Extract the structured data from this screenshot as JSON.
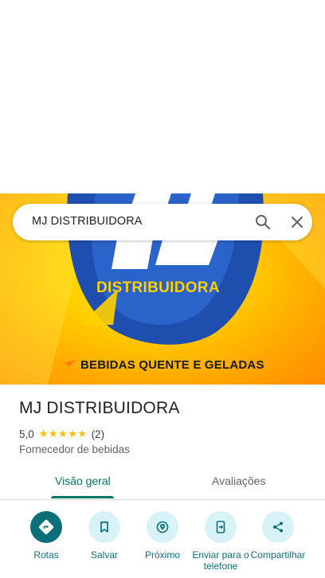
{
  "hero": {
    "brand_word": "DISTRIBUIDORA",
    "tagline": "BEBIDAS QUENTE E GELADAS"
  },
  "search": {
    "query": "MJ DISTRIBUIDORA"
  },
  "place": {
    "name": "MJ DISTRIBUIDORA",
    "rating": "5,0",
    "stars": "★★★★★",
    "review_count": "(2)",
    "category": "Fornecedor de bebidas"
  },
  "tabs": [
    {
      "label": "Visão geral",
      "active": true
    },
    {
      "label": "Avaliações",
      "active": false
    }
  ],
  "actions": [
    {
      "label": "Rotas",
      "icon": "directions-icon"
    },
    {
      "label": "Salvar",
      "icon": "bookmark-icon"
    },
    {
      "label": "Próximo",
      "icon": "nearby-icon"
    },
    {
      "label": "Enviar para o telefone",
      "icon": "send-to-phone-icon"
    },
    {
      "label": "Compartilhar",
      "icon": "share-icon"
    }
  ],
  "colors": {
    "accent": "#00796b",
    "action_primary": "#0b6f7a",
    "action_bg": "#d8f3f7",
    "star": "#fbbc04",
    "hero_yellow": "#ffd000",
    "logo_blue": "#1f4fae"
  }
}
